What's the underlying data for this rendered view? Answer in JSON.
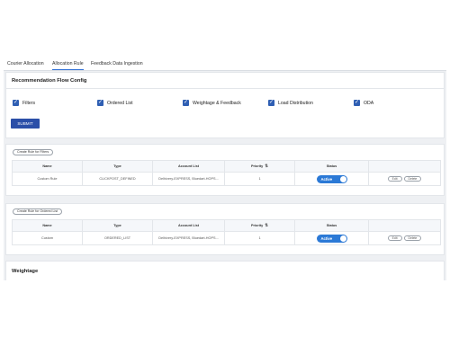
{
  "tabs": [
    {
      "label": "Courier Allocation",
      "active": false
    },
    {
      "label": "Allocation Rule",
      "active": true
    },
    {
      "label": "Feedback Data Ingestion",
      "active": false
    }
  ],
  "config": {
    "title": "Recommendation Flow Config",
    "checkboxes": [
      {
        "label": "Filters",
        "checked": true
      },
      {
        "label": "Ordered List",
        "checked": true
      },
      {
        "label": "Weightage & Feedback",
        "checked": true
      },
      {
        "label": "Load Distribution",
        "checked": true
      },
      {
        "label": "ODA",
        "checked": true
      }
    ],
    "submit_label": "SUBMIT"
  },
  "columns": [
    "Name",
    "Type",
    "Account List",
    "Priority",
    "Status",
    ""
  ],
  "sort_icon": "sort-icon",
  "filter_rules": {
    "create_label": "Create Rule for Filters",
    "rows": [
      {
        "name": "Custom Rule",
        "type": "CLICKPOST_DEFINED",
        "account_list": "Delhivery-EXPRESS, Bluedart-HOPS...",
        "priority": "1",
        "status": "Active",
        "edit": "Edit",
        "delete": "Delete"
      }
    ]
  },
  "ordered_rules": {
    "create_label": "Create Rule for Ordered List",
    "rows": [
      {
        "name": "Custom",
        "type": "ORDERED_LIST",
        "account_list": "Delhivery-EXPRESS, Bluedart-HOPS...",
        "priority": "1",
        "status": "Active",
        "edit": "Edit",
        "delete": "Delete"
      }
    ]
  },
  "weightage": {
    "title": "Weightage"
  },
  "colors": {
    "accent": "#2f5fb3",
    "toggle": "#2b79d6",
    "background": "#eef0f3"
  }
}
